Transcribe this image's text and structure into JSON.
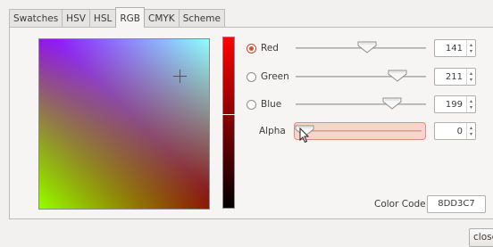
{
  "tabs": [
    {
      "label": "Swatches",
      "active": false
    },
    {
      "label": "HSV",
      "active": false
    },
    {
      "label": "HSL",
      "active": false
    },
    {
      "label": "RGB",
      "active": true
    },
    {
      "label": "CMYK",
      "active": false
    },
    {
      "label": "Scheme",
      "active": false
    }
  ],
  "channels": {
    "red": {
      "label": "Red",
      "value": "141",
      "checked": true,
      "slider_fraction": 0.553
    },
    "green": {
      "label": "Green",
      "value": "211",
      "checked": false,
      "slider_fraction": 0.827
    },
    "blue": {
      "label": "Blue",
      "value": "199",
      "checked": false,
      "slider_fraction": 0.78
    },
    "alpha": {
      "label": "Alpha",
      "value": "0",
      "slider_fraction": 0.0
    }
  },
  "color_code": {
    "label": "Color Code",
    "value": "8DD3C7"
  },
  "close_label": "close",
  "colors": {
    "accent": "#d9502f",
    "alpha_highlight": "#f6d6cc"
  },
  "icons": {
    "spin_up": "▴",
    "spin_down": "▾",
    "crosshair": "crosshair-icon",
    "cursor": "mouse-pointer-icon"
  }
}
